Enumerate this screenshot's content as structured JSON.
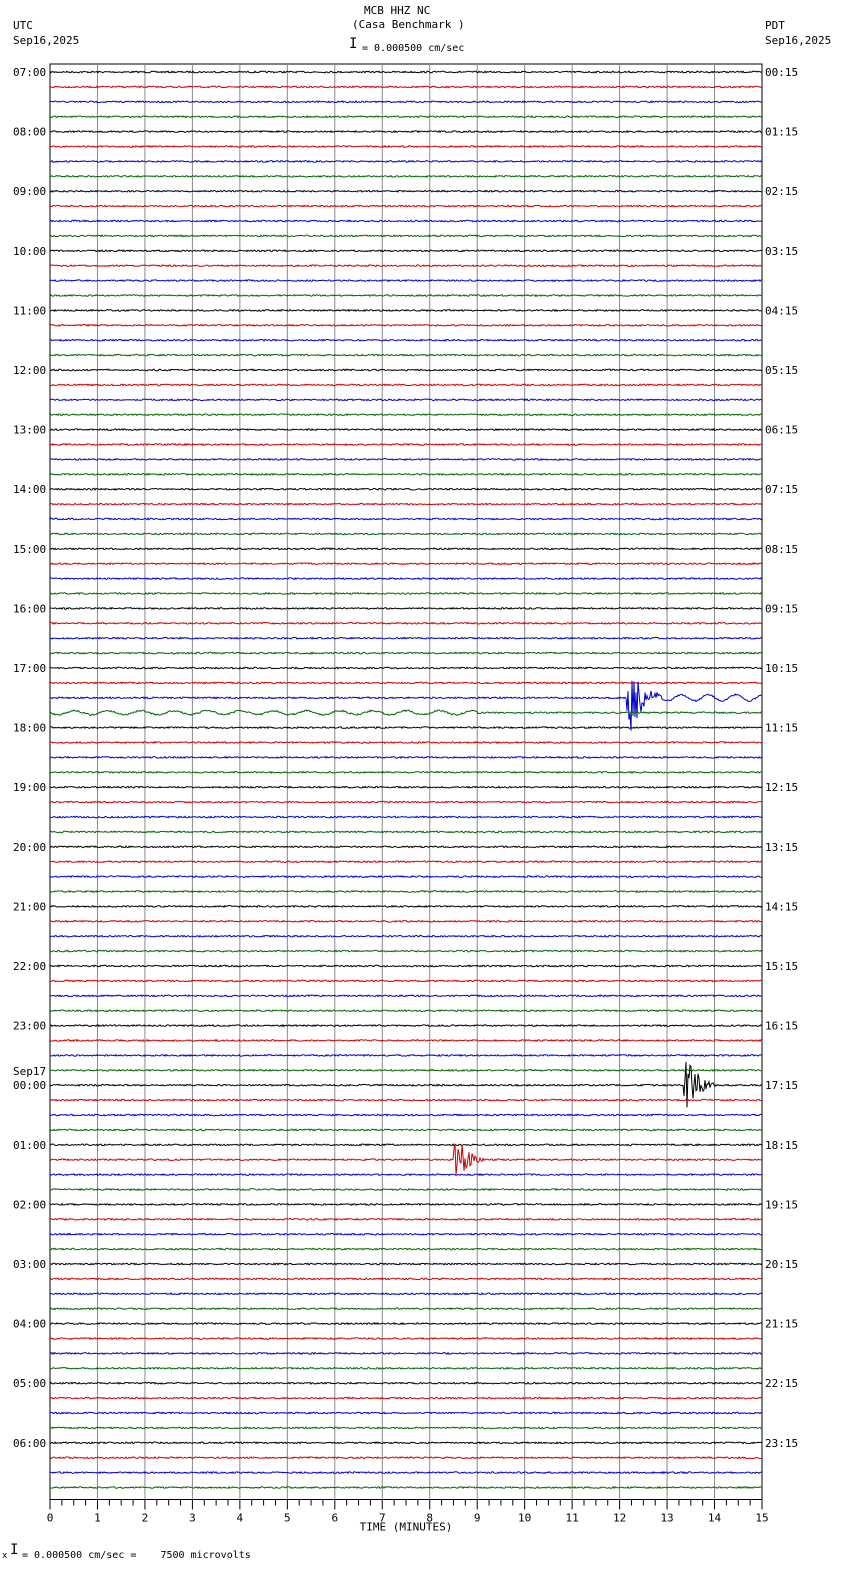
{
  "header": {
    "title": "MCB HHZ NC",
    "subtitle": "(Casa Benchmark )",
    "left_tz": "UTC",
    "left_date": "Sep16,2025",
    "right_tz": "PDT",
    "right_date": "Sep16,2025",
    "scale": "= 0.000500 cm/sec"
  },
  "footer": {
    "scale": "= 0.000500 cm/sec =    7500 microvolts",
    "prefix": "x"
  },
  "chart_data": {
    "type": "line",
    "title": "MCB HHZ NC (Casa Benchmark )",
    "xlabel": "TIME (MINUTES)",
    "xlim": [
      0,
      15
    ],
    "x_ticks": [
      "0",
      "1",
      "2",
      "3",
      "4",
      "5",
      "6",
      "7",
      "8",
      "9",
      "10",
      "11",
      "12",
      "13",
      "14",
      "15"
    ],
    "rows_per_hour": 4,
    "trace_colors": [
      "#000000",
      "#cc0000",
      "#0000cc",
      "#006600"
    ],
    "date_change_label": "Sep17",
    "left_labels": [
      "07:00",
      "08:00",
      "09:00",
      "10:00",
      "11:00",
      "12:00",
      "13:00",
      "14:00",
      "15:00",
      "16:00",
      "17:00",
      "18:00",
      "19:00",
      "20:00",
      "21:00",
      "22:00",
      "23:00",
      "00:00",
      "01:00",
      "02:00",
      "03:00",
      "04:00",
      "05:00",
      "06:00"
    ],
    "right_labels": [
      "00:15",
      "01:15",
      "02:15",
      "03:15",
      "04:15",
      "05:15",
      "06:15",
      "07:15",
      "08:15",
      "09:15",
      "10:15",
      "11:15",
      "12:15",
      "13:15",
      "14:15",
      "15:15",
      "16:15",
      "17:15",
      "18:15",
      "19:15",
      "20:15",
      "21:15",
      "22:15",
      "23:15"
    ],
    "events": [
      {
        "row": 42,
        "minute": 12.3,
        "amplitude": 4.5,
        "duration": 0.6,
        "long_period_tail": true
      },
      {
        "row": 43,
        "minute": 0.0,
        "amplitude": 0,
        "duration": 0,
        "long_period_start": true
      },
      {
        "row": 68,
        "minute": 13.5,
        "amplitude": 3.0,
        "duration": 0.6
      },
      {
        "row": 73,
        "minute": 8.65,
        "amplitude": 2.3,
        "duration": 0.5
      }
    ]
  }
}
